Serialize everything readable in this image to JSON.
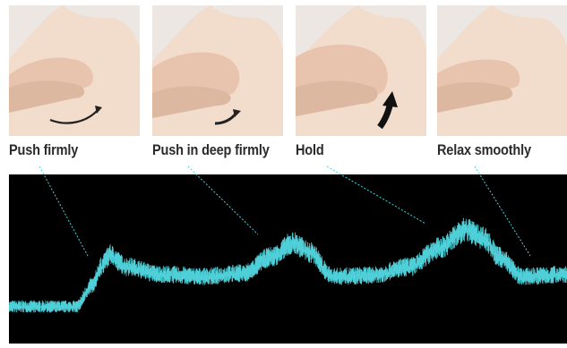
{
  "steps": [
    {
      "label": "Push firmly",
      "arrow": "curved-arrow-right-icon"
    },
    {
      "label": "Push in deep firmly",
      "arrow": "curved-arrow-right-icon"
    },
    {
      "label": "Hold",
      "arrow": "bold-arrow-up-icon"
    },
    {
      "label": "Relax smoothly",
      "arrow": "none"
    }
  ],
  "colors": {
    "skin_light": "#f2dccb",
    "skin_shadow": "#dcb8a1",
    "photo_bg": "#ece7e3",
    "waveform": "#4fd0d8",
    "scope_bg": "#000000",
    "label_text": "#2b2b2b"
  },
  "waveform": {
    "keypoints": [
      [
        0,
        0.0
      ],
      [
        0.12,
        0.0
      ],
      [
        0.15,
        0.2
      ],
      [
        0.165,
        0.37
      ],
      [
        0.18,
        0.48
      ],
      [
        0.21,
        0.37
      ],
      [
        0.27,
        0.3
      ],
      [
        0.35,
        0.28
      ],
      [
        0.42,
        0.31
      ],
      [
        0.47,
        0.46
      ],
      [
        0.51,
        0.59
      ],
      [
        0.54,
        0.5
      ],
      [
        0.58,
        0.28
      ],
      [
        0.65,
        0.29
      ],
      [
        0.72,
        0.37
      ],
      [
        0.77,
        0.54
      ],
      [
        0.82,
        0.71
      ],
      [
        0.85,
        0.64
      ],
      [
        0.88,
        0.46
      ],
      [
        0.92,
        0.28
      ],
      [
        1.0,
        0.3
      ]
    ],
    "noise": 0.06
  }
}
